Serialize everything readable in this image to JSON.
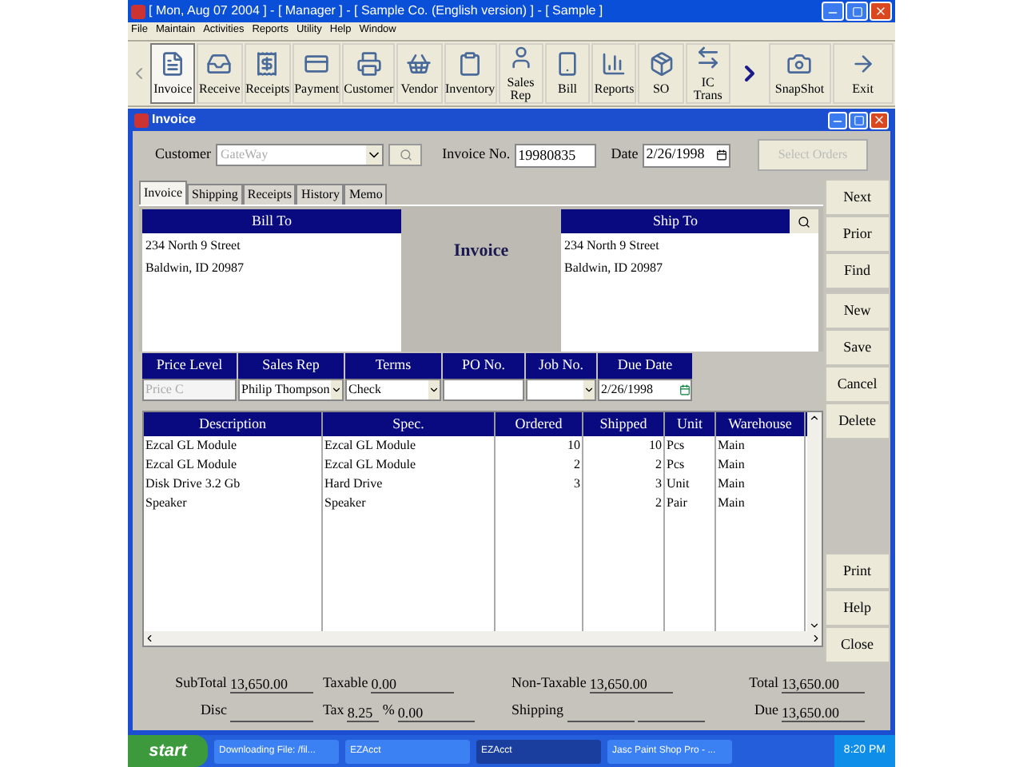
{
  "app_title": "[ Mon, Aug 07 2004 ] - [ Manager ] - [ Sample Co. (English version) ] - [ Sample ]",
  "menu": [
    "File",
    "Maintain",
    "Activities",
    "Reports",
    "Utility",
    "Help",
    "Window"
  ],
  "toolbar": [
    {
      "label": "Invoice",
      "selected": true
    },
    {
      "label": "Receive",
      "selected": false
    },
    {
      "label": "Receipts",
      "selected": false
    },
    {
      "label": "Payment",
      "selected": false
    },
    {
      "label": "Customer",
      "selected": false
    },
    {
      "label": "Vendor",
      "selected": false
    },
    {
      "label": "Inventory",
      "selected": false
    },
    {
      "label": "Sales Rep",
      "selected": false
    },
    {
      "label": "Bill",
      "selected": false
    },
    {
      "label": "Reports",
      "selected": false
    },
    {
      "label": "SO",
      "selected": false
    },
    {
      "label": "IC Trans",
      "selected": false
    }
  ],
  "toolbar_right": [
    {
      "label": "SnapShot",
      "selected": false
    },
    {
      "label": "Exit",
      "selected": false
    }
  ],
  "window_title": "Invoice",
  "header": {
    "customer_label": "Customer",
    "customer_value": "GateWay",
    "customer_disabled": true,
    "invoice_no_label": "Invoice No.",
    "invoice_no": "19980835",
    "date_label": "Date",
    "date": "2/26/1998",
    "select_orders": "Select Orders",
    "select_orders_disabled": true
  },
  "tabs": [
    {
      "label": "Invoice",
      "selected": true
    },
    {
      "label": "Shipping",
      "selected": false
    },
    {
      "label": "Receipts",
      "selected": false
    },
    {
      "label": "History",
      "selected": false
    },
    {
      "label": "Memo",
      "selected": false
    }
  ],
  "bill_to": {
    "title": "Bill To",
    "lines": [
      "234 North 9 Street",
      "Baldwin, ID 20987"
    ]
  },
  "form_title": "Invoice",
  "ship_to": {
    "title": "Ship To",
    "lines": [
      "234 North 9 Street",
      "Baldwin, ID 20987"
    ]
  },
  "fields": [
    {
      "label": "Price Level",
      "value": "Price C",
      "kind": "text",
      "disabled": true
    },
    {
      "label": "Sales Rep",
      "value": "Philip Thompson",
      "kind": "dropdown"
    },
    {
      "label": "Terms",
      "value": "Check",
      "kind": "dropdown"
    },
    {
      "label": "PO No.",
      "kind": "text"
    },
    {
      "label": "Job No.",
      "kind": "dropdown"
    },
    {
      "label": "Due Date",
      "value": "2/26/1998",
      "kind": "date"
    }
  ],
  "table": {
    "columns": [
      "Description",
      "Spec.",
      "Ordered",
      "Shipped",
      "Unit",
      "Warehouse"
    ],
    "rows": [
      [
        "Ezcal GL Module",
        "Ezcal GL Module",
        "10",
        "10",
        "Pcs",
        "Main"
      ],
      [
        "Ezcal GL Module",
        "Ezcal GL Module",
        "2",
        "2",
        "Pcs",
        "Main"
      ],
      [
        "Disk Drive 3.2 Gb",
        "Hard Drive",
        "3",
        "3",
        "Unit",
        "Main"
      ],
      [
        "Speaker",
        "Speaker",
        "",
        "2",
        "Pair",
        "Main"
      ]
    ]
  },
  "side_buttons": [
    [
      "Next",
      "Prior",
      "Find"
    ],
    [
      "New",
      "Save",
      "Cancel",
      "Delete"
    ],
    [
      "Print",
      "Help",
      "Close"
    ]
  ],
  "totals": [
    [
      {
        "label": "SubTotal",
        "value": "13,650.00",
        "kind": "single"
      },
      {
        "label": "Taxable",
        "value": "0.00",
        "kind": "single"
      },
      {
        "label": "Non-Taxable",
        "value": "13,650.00",
        "kind": "single"
      },
      {
        "label": "Total",
        "value": "13,650.00",
        "kind": "single"
      }
    ],
    [
      {
        "label": "Disc",
        "kind": "single"
      },
      {
        "label": "Tax",
        "rate": "8.25",
        "suffix": "%",
        "value": "0.00",
        "kind": "tax"
      },
      {
        "label": "Shipping",
        "kind": "double"
      },
      {
        "label": "Due",
        "value": "13,650.00",
        "kind": "single"
      }
    ]
  ],
  "taskbar": {
    "start": "start",
    "items": [
      {
        "label": "Downloading File: /fil...",
        "selected": false
      },
      {
        "label": "EZAcct",
        "selected": false
      },
      {
        "label": "EZAcct",
        "selected": true
      },
      {
        "label": "Jasc Paint Shop Pro - ...",
        "selected": false
      }
    ],
    "clock": "8:20 PM"
  }
}
